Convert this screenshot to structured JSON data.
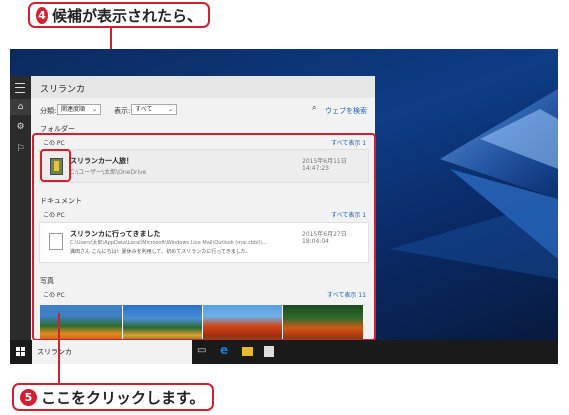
{
  "callouts": {
    "top": {
      "number": "4",
      "text": "候補が表示されたら、"
    },
    "bottom": {
      "number": "5",
      "text": "ここをクリックします。"
    }
  },
  "search": {
    "title": "スリランカ",
    "sort_label": "分類:",
    "sort_value": "関連度順",
    "show_label": "表示:",
    "show_value": "すべて",
    "web_search": "ウェブを検索"
  },
  "sections": {
    "folder": {
      "header": "フォルダー",
      "sub": "この PC",
      "show_all": "すべて表示 1",
      "item": {
        "title": "スリランカ一人旅！",
        "path": "C:\\ユーザー\\太郎\\OneDrive",
        "date": "2015年6月11日 14:47:23"
      }
    },
    "documents": {
      "header": "ドキュメント",
      "sub": "この PC",
      "show_all": "すべて表示 1",
      "item": {
        "title": "スリランカに行ってきました",
        "path": "C:\\Users\\太郎\\AppData\\Local\\Microsoft\\Windows Live Mail\\Outlook (mai.cbbl)\\...",
        "snippet": "満田さん こんにちは！夏休みを利用して、初めてスリランカに行ってきました。",
        "date": "2015年6月27日 18:04:04"
      }
    },
    "photos": {
      "header": "写真",
      "sub": "この PC",
      "show_all": "すべて表示 11"
    }
  },
  "taskbar": {
    "search_text": "スリランカ"
  },
  "colors": {
    "callout_red": "#d1202f",
    "link_blue": "#1a5fb4",
    "edge_blue": "#1d7bd8"
  },
  "icons": [
    "start-icon",
    "home-icon",
    "settings-icon",
    "feedback-icon",
    "task-view-icon",
    "edge-icon",
    "file-explorer-icon",
    "store-icon",
    "search-icon",
    "folder-icon",
    "document-icon"
  ]
}
